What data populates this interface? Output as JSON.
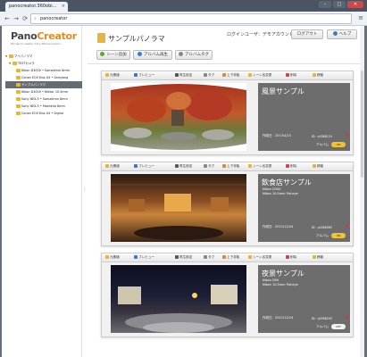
{
  "browser": {
    "tab_title": "panocreator.360obi...",
    "tab_close": "×",
    "url": "panocreator",
    "back": "←",
    "forward": "→",
    "reload": "⟳",
    "menu": "≡",
    "win_min": "–",
    "win_max": "□",
    "win_close": "✕"
  },
  "logo": {
    "pano": "Pano",
    "creator": "Creator",
    "tagline": "Pioneer to realize, more 360 panoramic..."
  },
  "sidebar": {
    "items": [
      {
        "label": "マイパノラマ",
        "toggle": "▼"
      },
      {
        "label": "TESTカメラ",
        "toggle": "▼"
      },
      {
        "label": "Nikon D3000 • Samalimm 8mm",
        "toggle": ""
      },
      {
        "label": "Canon EOS Kiss X4 • Samyang",
        "toggle": ""
      },
      {
        "label": "サンプルパノラマ",
        "toggle": ""
      },
      {
        "label": "Nikon D3000 • Nikkor 10.5mm",
        "toggle": ""
      },
      {
        "label": "Sony NEX-5 • Samalimm 8mm",
        "toggle": ""
      },
      {
        "label": "Sony NEX-5 • Mashkha 8mm",
        "toggle": ""
      },
      {
        "label": "Canon EOS Kiss X4 • Sigma",
        "toggle": ""
      }
    ]
  },
  "header": {
    "title": "サンプルパノラマ",
    "user": "ログインユーザ：デモアカウント",
    "logout": "ログアウト",
    "help": "ヘルプ"
  },
  "actions": {
    "add_scene": "シーン追加",
    "play_album": "アルバム再生",
    "album_tag": "アルバムタグ"
  },
  "card_toolbar": {
    "edit": "元素値",
    "preview": "プレビュー",
    "play_settings": "再生設定",
    "tag": "タグ",
    "move": "上下非転",
    "change_scene": "シーン名変更",
    "delete": "削除",
    "transfer": "移動"
  },
  "cards": [
    {
      "name": "風景サンプル",
      "meta": [
        "",
        ""
      ],
      "date_label": "作成日：",
      "date": "2013/4/15",
      "id": "ID：p2068119",
      "album_label": "アルバム",
      "toggle": "ON"
    },
    {
      "name": "飲食店サンプル",
      "meta": [
        "Nikon D300",
        "Nikon 10.5mm Fisheye"
      ],
      "date_label": "作成日：",
      "date": "2012/12/24",
      "id": "ID：p2068083",
      "album_label": "アルバム",
      "toggle": "ON"
    },
    {
      "name": "夜景サンプル",
      "meta": [
        "Nikon D90",
        "Nikon 10.5mm Fisheye"
      ],
      "date_label": "作成日：",
      "date": "2012/12/24",
      "id": "ID：p2068243",
      "album_label": "アルバム",
      "toggle": "OFF"
    }
  ],
  "colors": {
    "accent": "#e48a1b",
    "info_panel": "#6d6d6d",
    "toggle_on": "#f2c230"
  }
}
